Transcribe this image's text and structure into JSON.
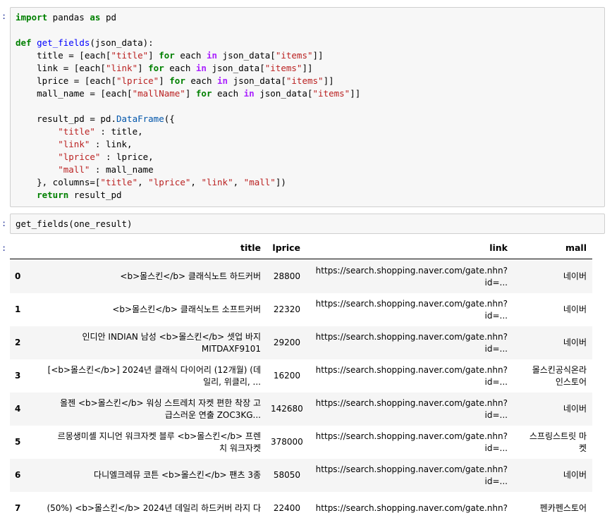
{
  "prompts": {
    "cell1": ":",
    "cell2": ":",
    "output": ":"
  },
  "code_cell_1": {
    "lines": [
      [
        [
          "kw",
          "import"
        ],
        [
          "t",
          " pandas "
        ],
        [
          "kw",
          "as"
        ],
        [
          "t",
          " pd"
        ]
      ],
      [],
      [
        [
          "kw",
          "def"
        ],
        [
          "t",
          " "
        ],
        [
          "fn",
          "get_fields"
        ],
        [
          "t",
          "(json_data):"
        ]
      ],
      [
        [
          "t",
          "    title = [each["
        ],
        [
          "st",
          "\"title\""
        ],
        [
          "t",
          "] "
        ],
        [
          "kw",
          "for"
        ],
        [
          "t",
          " each "
        ],
        [
          "op",
          "in"
        ],
        [
          "t",
          " json_data["
        ],
        [
          "st",
          "\"items\""
        ],
        [
          "t",
          "]]"
        ]
      ],
      [
        [
          "t",
          "    link = [each["
        ],
        [
          "st",
          "\"link\""
        ],
        [
          "t",
          "] "
        ],
        [
          "kw",
          "for"
        ],
        [
          "t",
          " each "
        ],
        [
          "op",
          "in"
        ],
        [
          "t",
          " json_data["
        ],
        [
          "st",
          "\"items\""
        ],
        [
          "t",
          "]]"
        ]
      ],
      [
        [
          "t",
          "    lprice = [each["
        ],
        [
          "st",
          "\"lprice\""
        ],
        [
          "t",
          "] "
        ],
        [
          "kw",
          "for"
        ],
        [
          "t",
          " each "
        ],
        [
          "op",
          "in"
        ],
        [
          "t",
          " json_data["
        ],
        [
          "st",
          "\"items\""
        ],
        [
          "t",
          "]]"
        ]
      ],
      [
        [
          "t",
          "    mall_name = [each["
        ],
        [
          "st",
          "\"mallName\""
        ],
        [
          "t",
          "] "
        ],
        [
          "kw",
          "for"
        ],
        [
          "t",
          " each "
        ],
        [
          "op",
          "in"
        ],
        [
          "t",
          " json_data["
        ],
        [
          "st",
          "\"items\""
        ],
        [
          "t",
          "]]"
        ]
      ],
      [],
      [
        [
          "t",
          "    result_pd = pd."
        ],
        [
          "attr",
          "DataFrame"
        ],
        [
          "t",
          "({"
        ]
      ],
      [
        [
          "t",
          "        "
        ],
        [
          "st",
          "\"title\""
        ],
        [
          "t",
          " : title,"
        ]
      ],
      [
        [
          "t",
          "        "
        ],
        [
          "st",
          "\"link\""
        ],
        [
          "t",
          " : link,"
        ]
      ],
      [
        [
          "t",
          "        "
        ],
        [
          "st",
          "\"lprice\""
        ],
        [
          "t",
          " : lprice,"
        ]
      ],
      [
        [
          "t",
          "        "
        ],
        [
          "st",
          "\"mall\""
        ],
        [
          "t",
          " : mall_name"
        ]
      ],
      [
        [
          "t",
          "    }, columns=["
        ],
        [
          "st",
          "\"title\""
        ],
        [
          "t",
          ", "
        ],
        [
          "st",
          "\"lprice\""
        ],
        [
          "t",
          ", "
        ],
        [
          "st",
          "\"link\""
        ],
        [
          "t",
          ", "
        ],
        [
          "st",
          "\"mall\""
        ],
        [
          "t",
          "])"
        ]
      ],
      [
        [
          "t",
          "    "
        ],
        [
          "kw",
          "return"
        ],
        [
          "t",
          " result_pd"
        ]
      ]
    ]
  },
  "code_cell_2": {
    "code": "get_fields(one_result)"
  },
  "dataframe": {
    "columns": {
      "title": "title",
      "lprice": "lprice",
      "link": "link",
      "mall": "mall"
    },
    "rows": [
      {
        "idx": "0",
        "title": "<b>몰스킨</b> 클래식노트 하드커버",
        "lprice": "28800",
        "link": "https://search.shopping.naver.com/gate.nhn?\nid=...",
        "mall": "네이버"
      },
      {
        "idx": "1",
        "title": "<b>몰스킨</b> 클래식노트 소프트커버",
        "lprice": "22320",
        "link": "https://search.shopping.naver.com/gate.nhn?\nid=...",
        "mall": "네이버"
      },
      {
        "idx": "2",
        "title": "인디안 INDIAN 남성 <b>몰스킨</b> 셋업 바지\nMITDAXF9101",
        "lprice": "29200",
        "link": "https://search.shopping.naver.com/gate.nhn?\nid=...",
        "mall": "네이버"
      },
      {
        "idx": "3",
        "title": "[<b>몰스킨</b>] 2024년 클래식 다이어리 (12개월) (데\n일리, 위클리, ...",
        "lprice": "16200",
        "link": "https://search.shopping.naver.com/gate.nhn?\nid=...",
        "mall": "몰스킨공식온라\n인스토어"
      },
      {
        "idx": "4",
        "title": "올젠 <b>몰스킨</b> 워싱 스트레치 자켓 편한 착장 고\n급스러운 연출 ZOC3KG...",
        "lprice": "142680",
        "link": "https://search.shopping.naver.com/gate.nhn?\nid=...",
        "mall": "네이버"
      },
      {
        "idx": "5",
        "title": "르몽생미셸 지니언 워크자켓 블루 <b>몰스킨</b> 프렌\n치 워크자켓",
        "lprice": "378000",
        "link": "https://search.shopping.naver.com/gate.nhn?\nid=...",
        "mall": "스프링스트릿 마\n켓"
      },
      {
        "idx": "6",
        "title": "다니엘크레뮤 코튼 <b>몰스킨</b> 팬츠 3종",
        "lprice": "58050",
        "link": "https://search.shopping.naver.com/gate.nhn?\nid=...",
        "mall": "네이버"
      },
      {
        "idx": "7",
        "title": "(50%) <b>몰스킨</b> 2024년 데일리 하드커버 라지 다",
        "lprice": "22400",
        "link": "https://search.shopping.naver.com/gate.nhn?",
        "mall": "펜카펜스토어"
      }
    ]
  }
}
